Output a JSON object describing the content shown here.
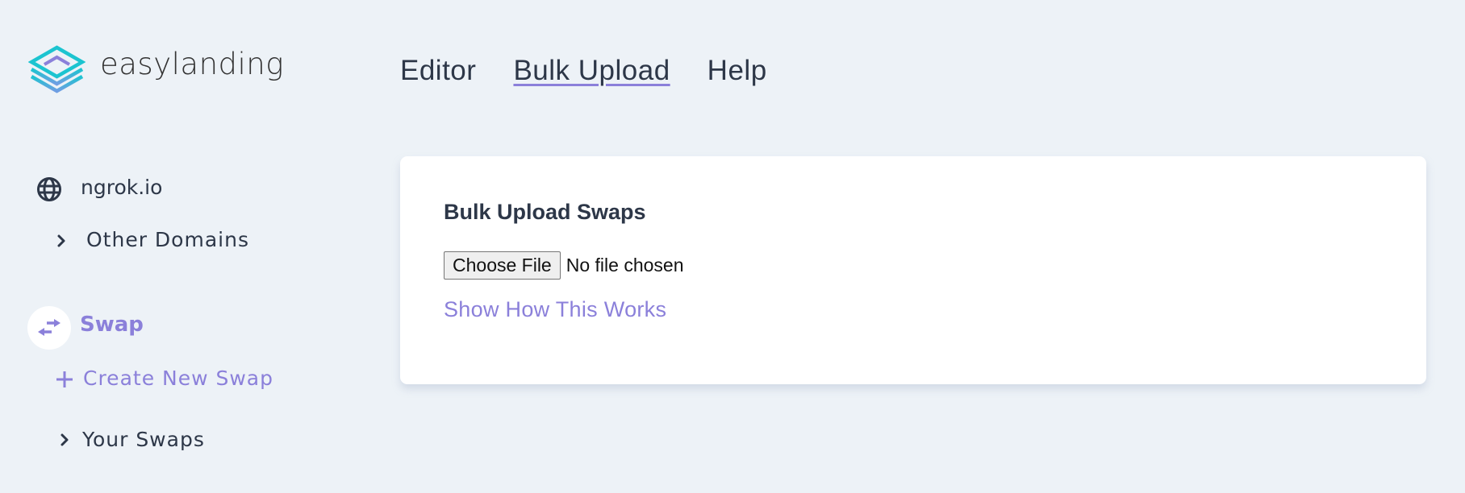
{
  "brand": {
    "name": "easylanding",
    "logo_icon": "layers-diamond-logo"
  },
  "nav": {
    "items": [
      {
        "label": "Editor",
        "active": false
      },
      {
        "label": "Bulk Upload",
        "active": true
      },
      {
        "label": "Help",
        "active": false
      }
    ]
  },
  "sidebar": {
    "domain": {
      "icon": "globe-icon",
      "label": "ngrok.io"
    },
    "other_domains": {
      "icon": "chevron-right-icon",
      "label": "Other Domains"
    },
    "section": {
      "icon": "swap-arrows-icon",
      "label": "Swap"
    },
    "create": {
      "icon": "plus-icon",
      "label": "Create New Swap"
    },
    "your_swaps": {
      "icon": "chevron-right-icon",
      "label": "Your Swaps"
    }
  },
  "card": {
    "title": "Bulk Upload Swaps",
    "file_input": {
      "button_label": "Choose File",
      "status": "No file chosen"
    },
    "help_link": "Show How This Works"
  },
  "colors": {
    "accent": "#8b80da",
    "text": "#2d3748",
    "background": "#edf2f7",
    "logo_teal": "#1cc4d0",
    "logo_purple": "#8b80da"
  }
}
